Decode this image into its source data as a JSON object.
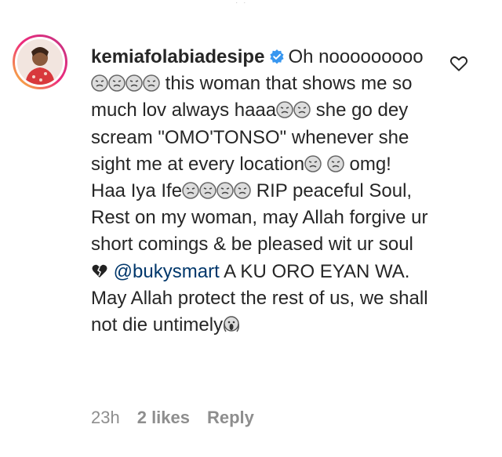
{
  "comment": {
    "username": "kemiafolabiadesipe",
    "text_parts": {
      "p1": "Oh nooooooooo",
      "p2": " this woman that shows me so much lov always haaa",
      "p3": " she go dey scream \"OMO'TONSO\" whenever she sight me at every location",
      "p4": " omg! Haa Iya Ife",
      "p5": " RIP peaceful Soul, Rest on my woman, may Allah forgive ur short comings & be pleased wit ur soul ",
      "mention": "@bukysmart",
      "p6": " A KU ORO EYAN WA. May Allah protect the rest of us, we shall not die untimely"
    },
    "timestamp": "23h",
    "likes": "2 likes",
    "reply_label": "Reply"
  },
  "icons": {
    "avatar": "avatar",
    "verified": "verified-badge-icon",
    "like": "heart-outline-icon",
    "emoji_tired": "weary-face-emoji",
    "emoji_heart": "broken-heart-emoji",
    "emoji_scream": "screaming-face-emoji"
  },
  "colors": {
    "text": "#262626",
    "muted": "#8e8e8e",
    "mention": "#00376b",
    "verified": "#3897f0"
  }
}
